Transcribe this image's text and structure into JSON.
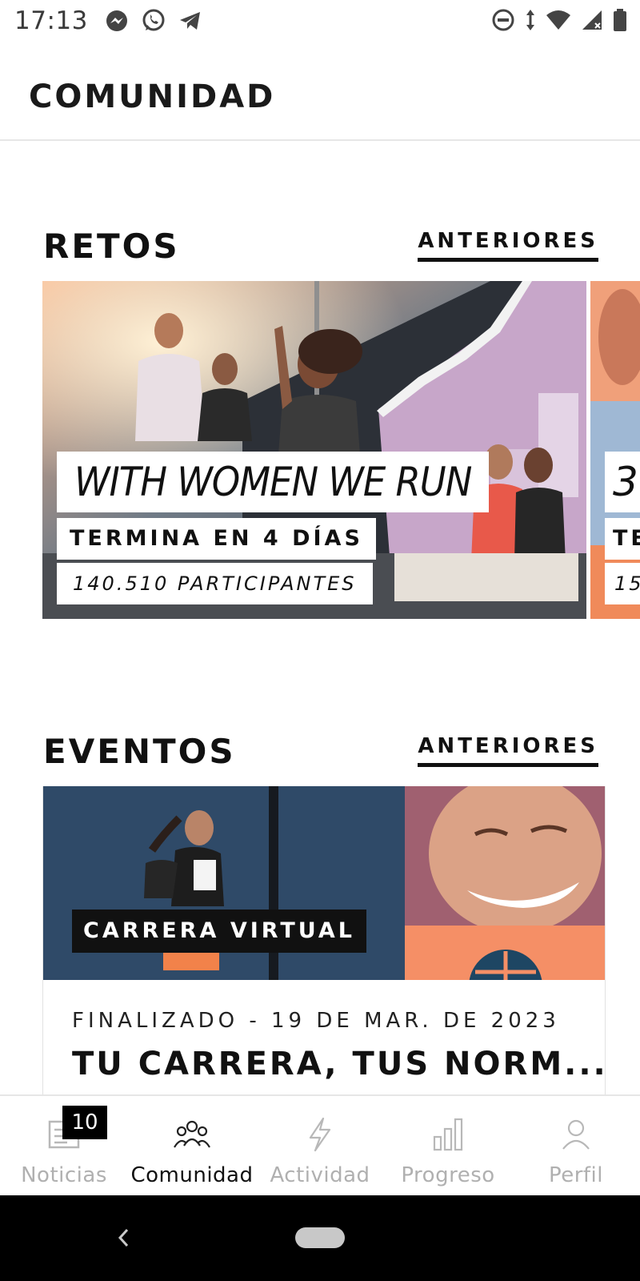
{
  "status_bar": {
    "time": "17:13",
    "left_icons": [
      "messenger-icon",
      "whatsapp-icon",
      "telegram-icon"
    ],
    "right_icons": [
      "do-not-disturb-icon",
      "data-arrows-icon",
      "wifi-icon",
      "signal-icon",
      "battery-icon"
    ]
  },
  "header": {
    "title": "COMUNIDAD"
  },
  "challenges": {
    "title": "RETOS",
    "previous_link": "ANTERIORES",
    "card": {
      "name": "WITH WOMEN WE RUN",
      "deadline": "TERMINA EN 4 DÍAS",
      "participants": "140.510 PARTICIPANTES"
    },
    "next_card_peek": {
      "name_fragment": "3",
      "deadline_fragment": "TE",
      "participants_fragment": "15"
    }
  },
  "events": {
    "title": "EVENTOS",
    "previous_link": "ANTERIORES",
    "card": {
      "badge": "CARRERA VIRTUAL",
      "meta": "FINALIZADO - 19 DE MAR. DE 2023",
      "title": "TU CARRERA, TUS NORM..."
    }
  },
  "bottom_nav": {
    "items": [
      {
        "label": "Noticias",
        "icon": "newspaper-icon",
        "badge": "10",
        "active": false
      },
      {
        "label": "Comunidad",
        "icon": "community-icon",
        "active": true
      },
      {
        "label": "Actividad",
        "icon": "lightning-icon",
        "active": false
      },
      {
        "label": "Progreso",
        "icon": "bar-chart-icon",
        "active": false
      },
      {
        "label": "Perfil",
        "icon": "person-icon",
        "active": false
      }
    ]
  },
  "colors": {
    "accent": "#111111",
    "inactive_nav": "#b0b0b0",
    "event_orange": "#f28a5e",
    "challenge_purple": "#c7a6c9"
  }
}
